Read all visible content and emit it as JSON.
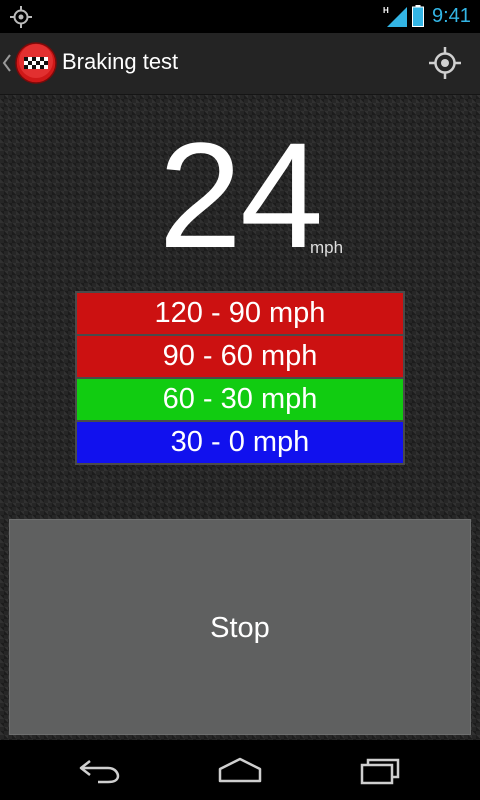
{
  "status_bar": {
    "time": "9:41",
    "network_type": "H",
    "icons": [
      "gps-icon",
      "signal-icon",
      "battery-icon"
    ],
    "time_color": "#33b5e5"
  },
  "action_bar": {
    "title": "Braking test",
    "icons": [
      "back-chevron-icon",
      "checkered-flag-icon",
      "locate-icon"
    ]
  },
  "speed": {
    "value": "24",
    "unit": "mph"
  },
  "ranges": [
    {
      "label": "120 - 90 mph",
      "color": "#cc1111"
    },
    {
      "label": "90 - 60 mph",
      "color": "#cc1111"
    },
    {
      "label": "60 - 30 mph",
      "color": "#11cc11"
    },
    {
      "label": "30 - 0 mph",
      "color": "#1111ee"
    }
  ],
  "stop_button": {
    "label": "Stop"
  },
  "nav_bar": {
    "icons": [
      "nav-back-icon",
      "nav-home-icon",
      "nav-recents-icon"
    ]
  }
}
